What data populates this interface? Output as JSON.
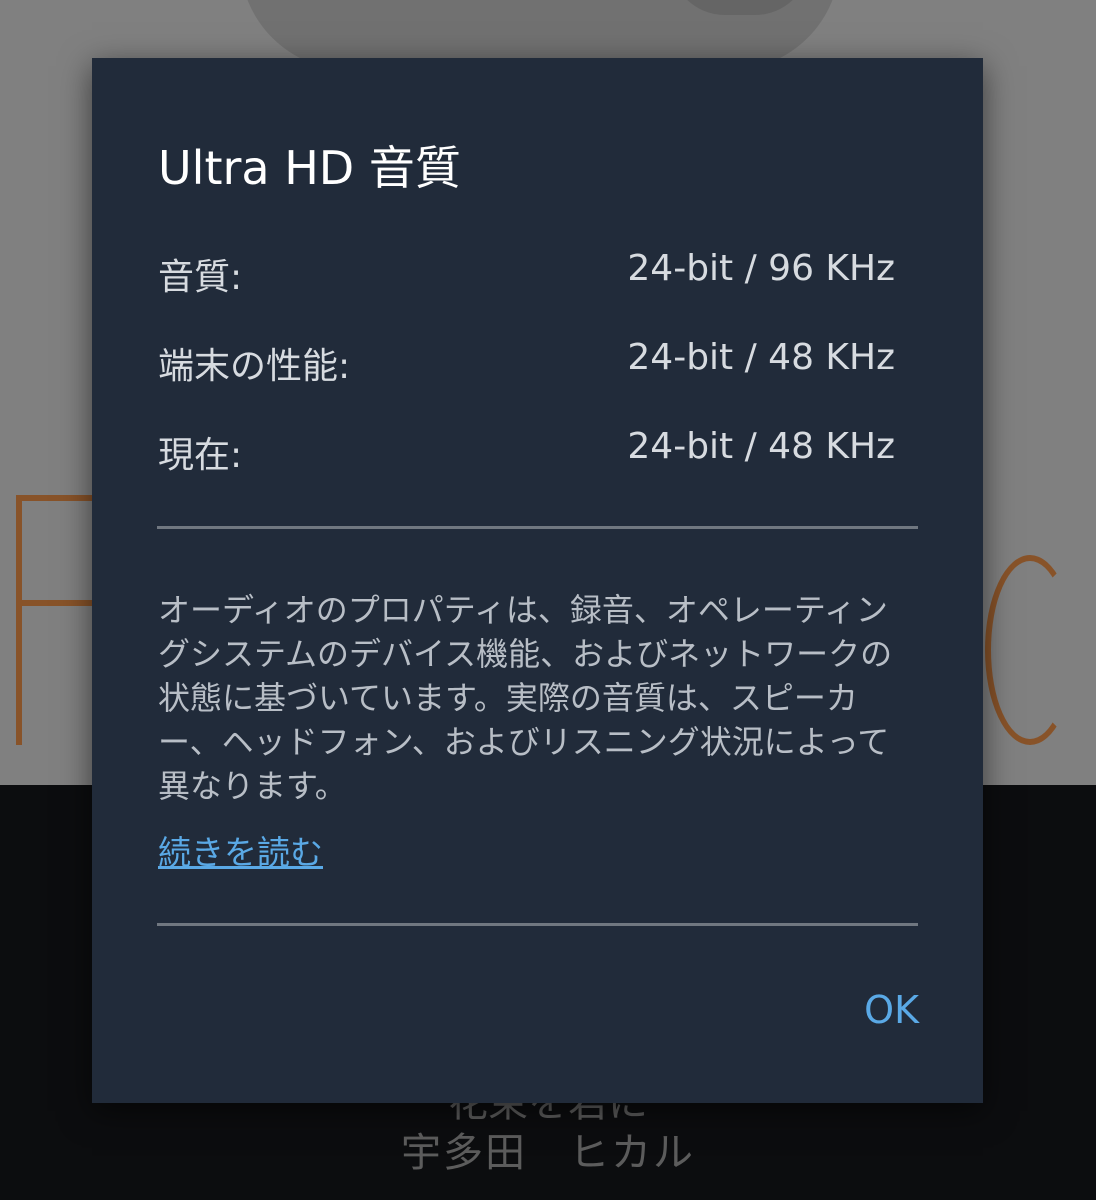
{
  "background": {
    "track_title": "花束を君に",
    "track_artist": "宇多田　ヒカル"
  },
  "dialog": {
    "title": "Ultra HD 音質",
    "specs": [
      {
        "label": "音質:",
        "value": "24-bit / 96 KHz"
      },
      {
        "label": "端末の性能:",
        "value": "24-bit / 48 KHz"
      },
      {
        "label": "現在:",
        "value": "24-bit / 48 KHz"
      }
    ],
    "description": "オーディオのプロパティは、録音、オペレーティングシステムのデバイス機能、およびネットワークの状態に基づいています。実際の音質は、スピーカー、ヘッドフォン、およびリスニング状況によって異なります。",
    "read_more_label": "続きを読む",
    "ok_label": "OK"
  },
  "colors": {
    "dialog_background": "#212b3a",
    "accent_link": "#5aa9e6",
    "album_text_accent": "#e38a45"
  }
}
